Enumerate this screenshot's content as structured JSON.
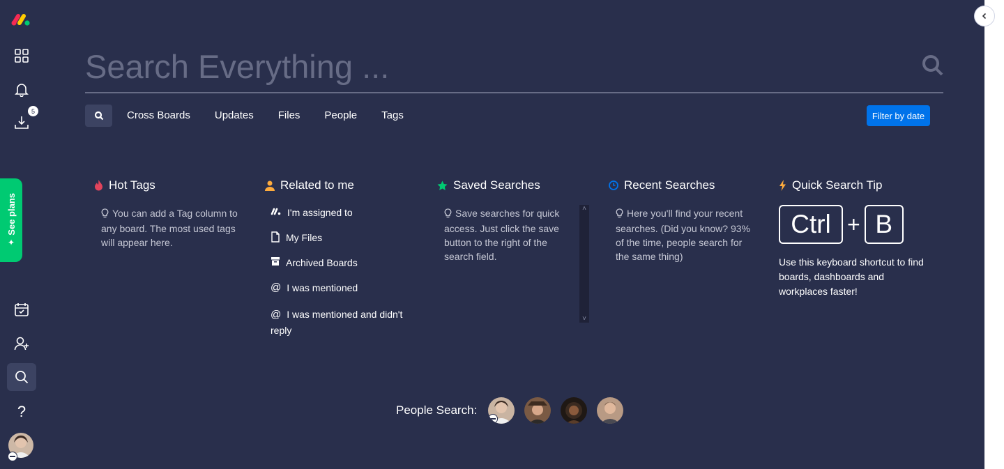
{
  "app": {
    "accent_color": "#0073ea",
    "background_color": "#292f4c",
    "green_color": "#00ca72"
  },
  "rail": {
    "items": [
      {
        "name": "logo",
        "icon": "monday-logo"
      },
      {
        "name": "workspaces",
        "icon": "grid-icon"
      },
      {
        "name": "notifications",
        "icon": "bell-icon"
      },
      {
        "name": "inbox",
        "icon": "download-tray-icon",
        "badge": "5"
      },
      {
        "name": "my-work",
        "icon": "calendar-check-icon"
      },
      {
        "name": "invite",
        "icon": "add-user-icon"
      },
      {
        "name": "search",
        "icon": "search-icon",
        "active": true
      },
      {
        "name": "help",
        "icon": "question-icon"
      },
      {
        "name": "profile",
        "icon": "avatar"
      }
    ],
    "see_plans_label": "See plans"
  },
  "search": {
    "placeholder": "Search Everything ...",
    "tabs": [
      "Cross Boards",
      "Updates",
      "Files",
      "People",
      "Tags"
    ],
    "filter_by_date_label": "Filter by date"
  },
  "sections": {
    "hot_tags": {
      "title": "Hot Tags",
      "hint": "You can add a Tag column to any board. The most used tags will appear here."
    },
    "related": {
      "title": "Related to me",
      "items": [
        {
          "label": "I'm assigned to",
          "icon": "monday-logo-icon"
        },
        {
          "label": "My Files",
          "icon": "file-icon"
        },
        {
          "label": "Archived Boards",
          "icon": "archive-icon"
        },
        {
          "label": "I was mentioned",
          "icon": "at-icon"
        },
        {
          "label": "I was mentioned and didn't reply",
          "icon": "at-icon"
        }
      ]
    },
    "saved": {
      "title": "Saved Searches",
      "hint": "Save searches for quick access. Just click the save button to the right of the search field."
    },
    "recent": {
      "title": "Recent Searches",
      "hint": "Here you'll find your recent searches. (Did you know? 93% of the time, people search for the same thing)"
    },
    "tip": {
      "title": "Quick Search Tip",
      "key1": "Ctrl",
      "plus": "+",
      "key2": "B",
      "text": "Use this keyboard shortcut to find boards, dashboards and workplaces faster!"
    }
  },
  "people": {
    "label": "People Search:",
    "avatars": [
      "person-1",
      "person-2",
      "person-3",
      "person-4"
    ]
  }
}
